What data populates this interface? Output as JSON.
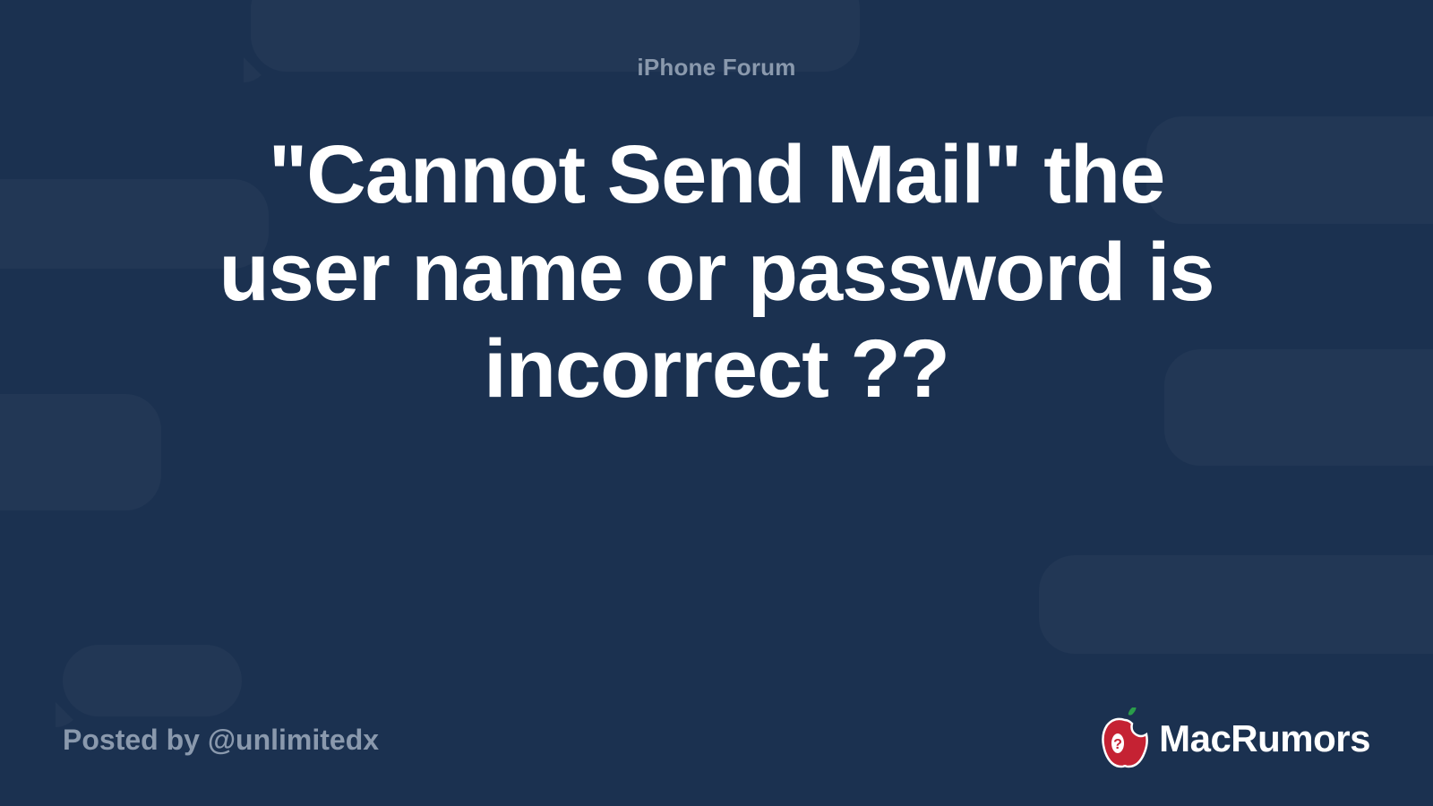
{
  "header": {
    "forum_label": "iPhone Forum"
  },
  "thread": {
    "title": "\"Cannot Send Mail\" the user name or password is incorrect ??"
  },
  "footer": {
    "posted_by": "Posted by @unlimitedx",
    "brand_name": "MacRumors"
  }
}
